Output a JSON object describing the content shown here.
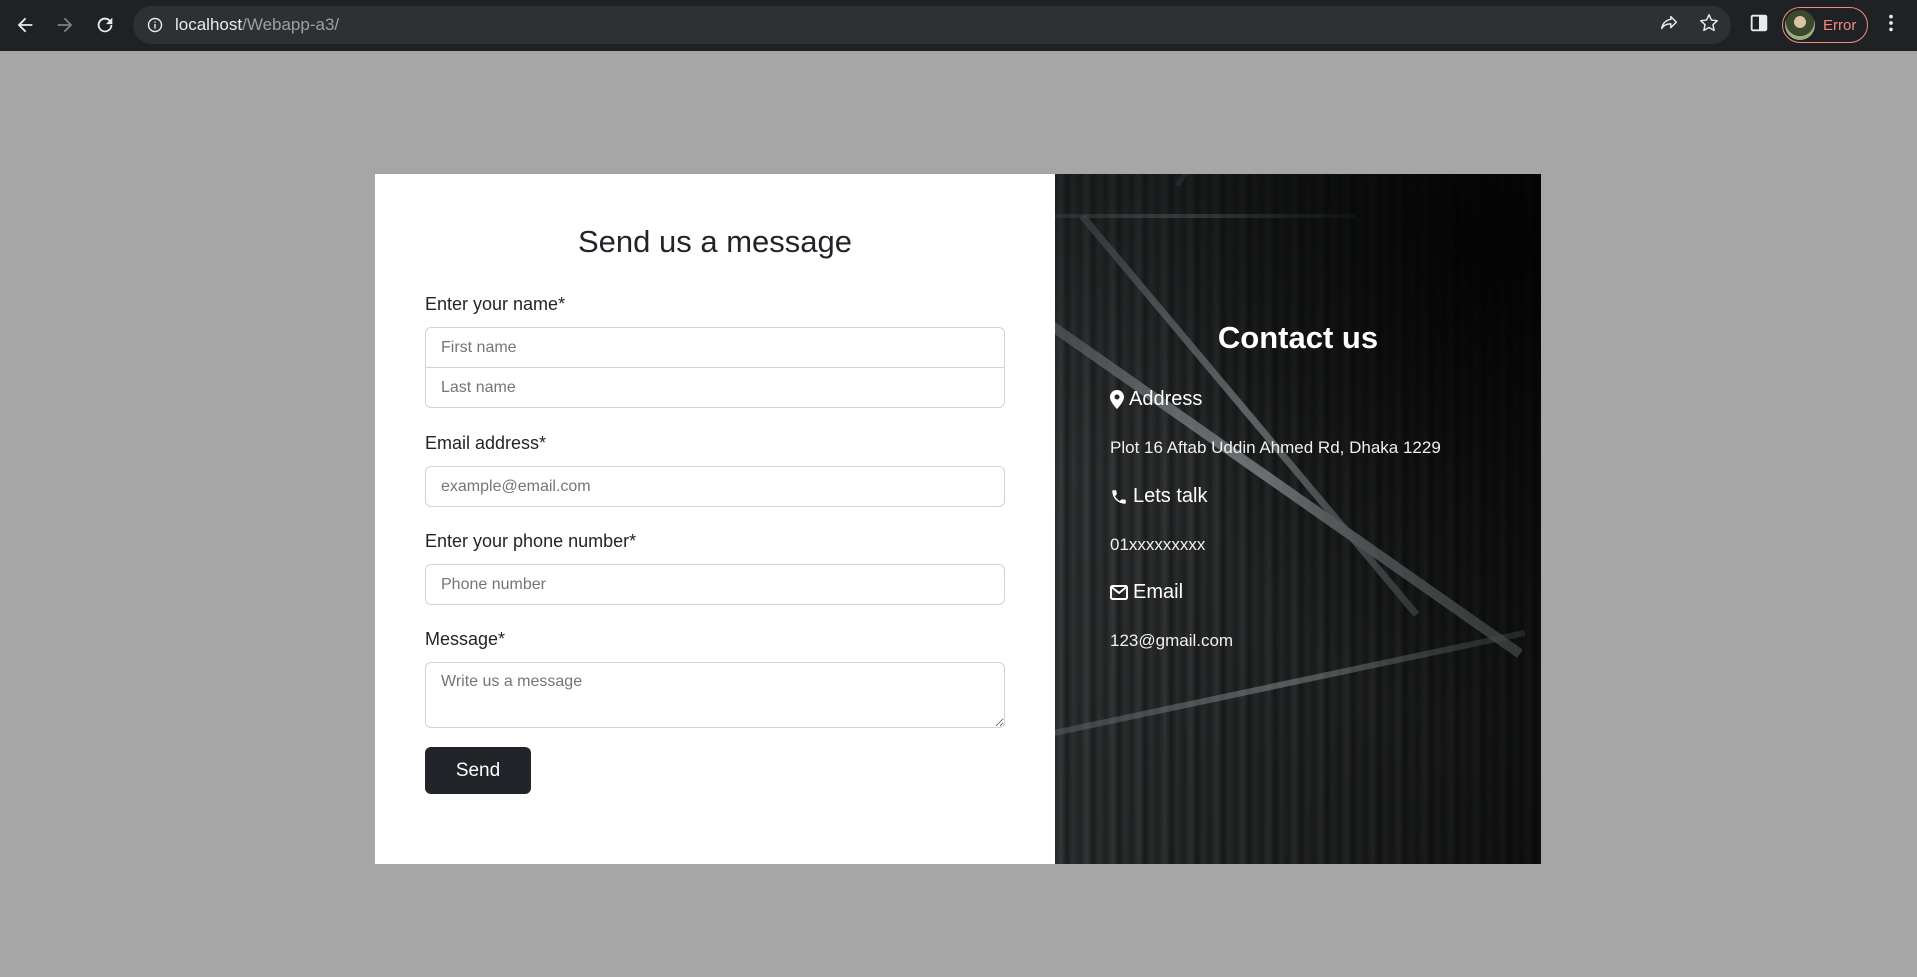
{
  "browser": {
    "url_host": "localhost",
    "url_path": "/Webapp-a3/",
    "profile_status": "Error"
  },
  "form": {
    "title": "Send us a message",
    "name_label": "Enter your name*",
    "first_name_placeholder": "First name",
    "last_name_placeholder": "Last name",
    "email_label": "Email address*",
    "email_placeholder": "example@email.com",
    "phone_label": "Enter your phone number*",
    "phone_placeholder": "Phone number",
    "message_label": "Message*",
    "message_placeholder": "Write us a message",
    "send_label": "Send"
  },
  "contact": {
    "title": "Contact us",
    "address_heading": "Address",
    "address_value": "Plot 16 Aftab Uddin Ahmed Rd, Dhaka 1229",
    "phone_heading": "Lets talk",
    "phone_value": "01xxxxxxxxx",
    "email_heading": "Email",
    "email_value": "123@gmail.com"
  },
  "colors": {
    "page_background": "#a6a6a6",
    "button_dark": "#212529",
    "profile_error": "#f28b82"
  }
}
